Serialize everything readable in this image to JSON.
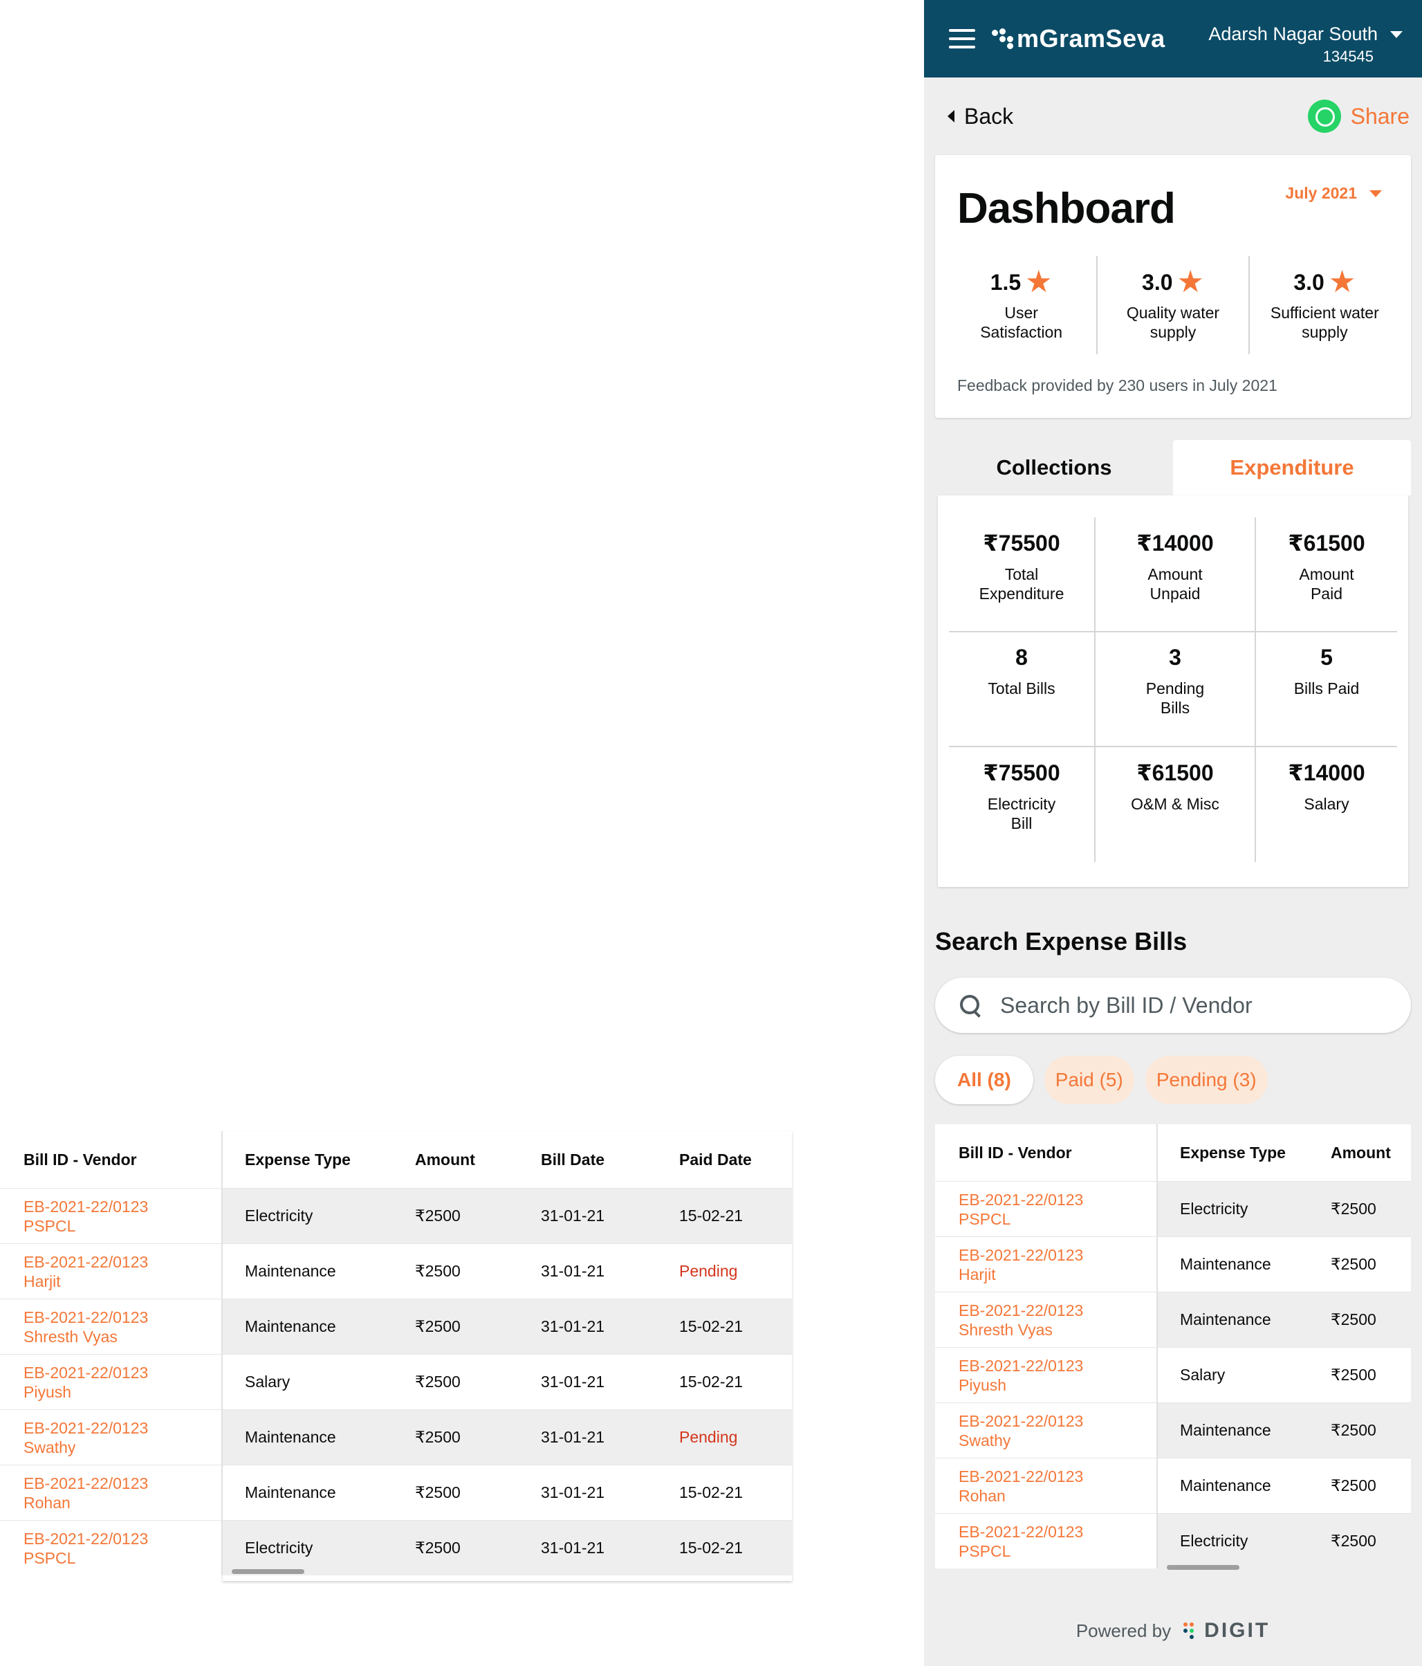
{
  "colors": {
    "brand": "#0b4b66",
    "accent": "#f47738",
    "pending": "#d4351c",
    "whatsapp": "#25d366"
  },
  "table_columns": [
    "Bill ID - Vendor",
    "Expense Type",
    "Amount",
    "Bill Date",
    "Paid Date"
  ],
  "bills": [
    {
      "id": "EB-2021-22/0123",
      "vendor": "PSPCL",
      "type": "Electricity",
      "amount": "₹2500",
      "bill_date": "31-01-21",
      "paid_date": "15-02-21"
    },
    {
      "id": "EB-2021-22/0123",
      "vendor": "Harjit",
      "type": "Maintenance",
      "amount": "₹2500",
      "bill_date": "31-01-21",
      "paid_date": "Pending"
    },
    {
      "id": "EB-2021-22/0123",
      "vendor": "Shresth Vyas",
      "type": "Maintenance",
      "amount": "₹2500",
      "bill_date": "31-01-21",
      "paid_date": "15-02-21"
    },
    {
      "id": "EB-2021-22/0123",
      "vendor": "Piyush",
      "type": "Salary",
      "amount": "₹2500",
      "bill_date": "31-01-21",
      "paid_date": "15-02-21"
    },
    {
      "id": "EB-2021-22/0123",
      "vendor": "Swathy",
      "type": "Maintenance",
      "amount": "₹2500",
      "bill_date": "31-01-21",
      "paid_date": "Pending"
    },
    {
      "id": "EB-2021-22/0123",
      "vendor": "Rohan",
      "type": "Maintenance",
      "amount": "₹2500",
      "bill_date": "31-01-21",
      "paid_date": "15-02-21"
    },
    {
      "id": "EB-2021-22/0123",
      "vendor": "PSPCL",
      "type": "Electricity",
      "amount": "₹2500",
      "bill_date": "31-01-21",
      "paid_date": "15-02-21"
    }
  ],
  "appbar": {
    "logo": "mGramSeva",
    "village_name": "Adarsh Nagar South",
    "village_code": "134545"
  },
  "nav": {
    "back": "Back",
    "share": "Share"
  },
  "dashboard": {
    "title": "Dashboard",
    "month": "July 2021",
    "ratings": [
      {
        "value": "1.5",
        "label_1": "User",
        "label_2": "Satisfaction"
      },
      {
        "value": "3.0",
        "label_1": "Quality water",
        "label_2": "supply"
      },
      {
        "value": "3.0",
        "label_1": "Sufficient water",
        "label_2": "supply"
      }
    ],
    "feedback": "Feedback provided by 230 users in July 2021"
  },
  "tabs": {
    "collections": "Collections",
    "expenditure": "Expenditure"
  },
  "expenditure": [
    {
      "value": "₹75500",
      "label_1": "Total",
      "label_2": "Expenditure"
    },
    {
      "value": "₹14000",
      "label_1": "Amount",
      "label_2": "Unpaid"
    },
    {
      "value": "₹61500",
      "label_1": "Amount",
      "label_2": "Paid"
    },
    {
      "value": "8",
      "label_1": "Total Bills",
      "label_2": ""
    },
    {
      "value": "3",
      "label_1": "Pending",
      "label_2": "Bills"
    },
    {
      "value": "5",
      "label_1": "Bills Paid",
      "label_2": ""
    },
    {
      "value": "₹75500",
      "label_1": "Electricity",
      "label_2": "Bill"
    },
    {
      "value": "₹61500",
      "label_1": "O&M & Misc",
      "label_2": ""
    },
    {
      "value": "₹14000",
      "label_1": "Salary",
      "label_2": ""
    }
  ],
  "search": {
    "title": "Search Expense Bills",
    "placeholder": "Search by Bill ID / Vendor"
  },
  "filters": {
    "all": "All (8)",
    "paid": "Paid (5)",
    "pending": "Pending (3)"
  },
  "footer": {
    "powered_by": "Powered by",
    "brand": "DIGIT"
  },
  "icons": [
    "hamburger-icon",
    "logo-icon",
    "chevron-down-icon",
    "back-caret-icon",
    "whatsapp-icon",
    "star-icon",
    "search-icon",
    "digit-logo-icon"
  ]
}
